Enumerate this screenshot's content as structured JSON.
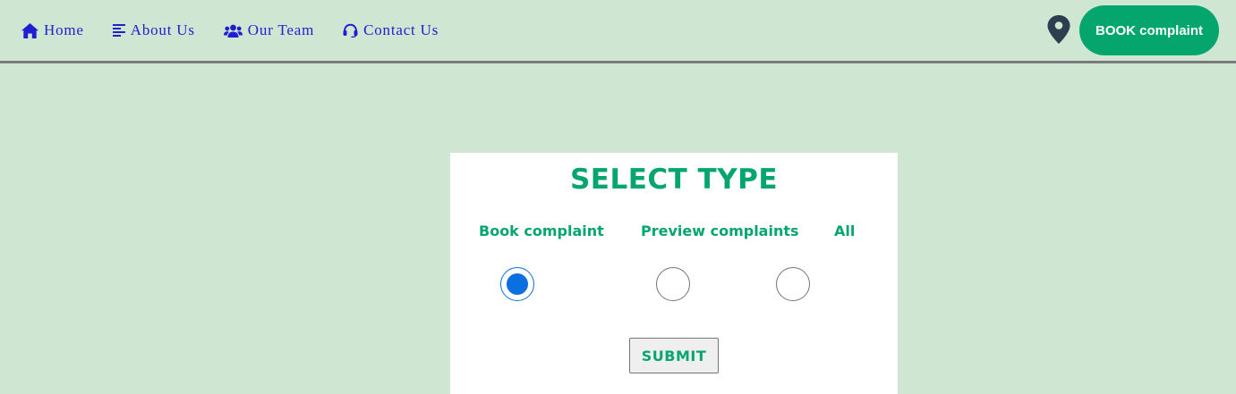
{
  "nav": {
    "items": [
      {
        "label": "Home",
        "icon": "home-icon"
      },
      {
        "label": "About Us",
        "icon": "align-left-icon"
      },
      {
        "label": "Our Team",
        "icon": "users-icon"
      },
      {
        "label": "Contact Us",
        "icon": "headset-icon"
      }
    ],
    "location_icon": "map-pin-icon",
    "book_button": "BOOK complaint"
  },
  "form": {
    "title": "SELECT TYPE",
    "options": [
      {
        "label": "Book complaint",
        "checked": true
      },
      {
        "label": "Preview complaints",
        "checked": false
      },
      {
        "label": "All",
        "checked": false
      }
    ],
    "submit_label": "SUBMIT"
  },
  "colors": {
    "background": "#cfe6d3",
    "accent": "#05a56e",
    "nav_link": "#1f1fd1",
    "radio_checked": "#0a6fe0"
  }
}
